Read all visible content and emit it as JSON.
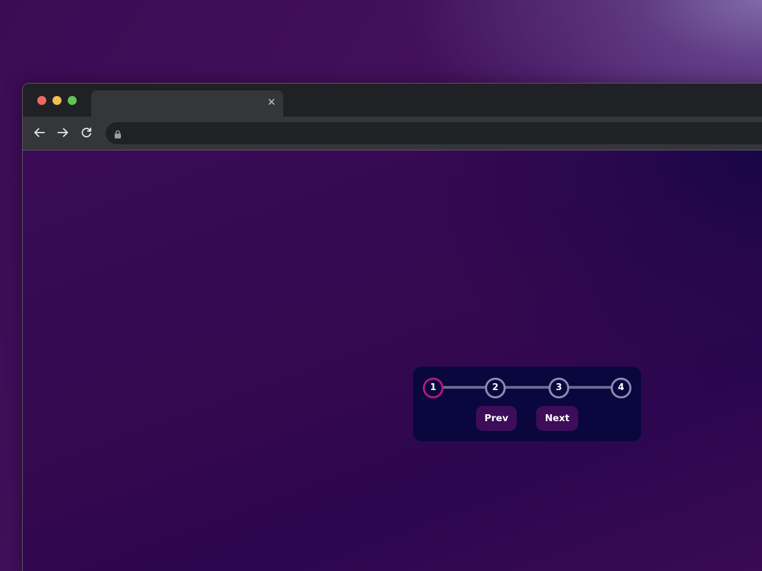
{
  "browser": {
    "tab": {
      "title": "",
      "close_icon": "close-icon"
    },
    "toolbar": {
      "back_icon": "arrow-left-icon",
      "forward_icon": "arrow-right-icon",
      "reload_icon": "reload-icon",
      "lock_icon": "lock-icon",
      "url": ""
    }
  },
  "stepper": {
    "steps": [
      {
        "label": "1",
        "active": true
      },
      {
        "label": "2",
        "active": false
      },
      {
        "label": "3",
        "active": false
      },
      {
        "label": "4",
        "active": false
      }
    ],
    "prev_label": "Prev",
    "next_label": "Next"
  },
  "colors": {
    "active_step": "#b5187a",
    "inactive_step": "#8f8bb0",
    "card_background": "#09073d",
    "button_background": "#3d0d5a"
  }
}
